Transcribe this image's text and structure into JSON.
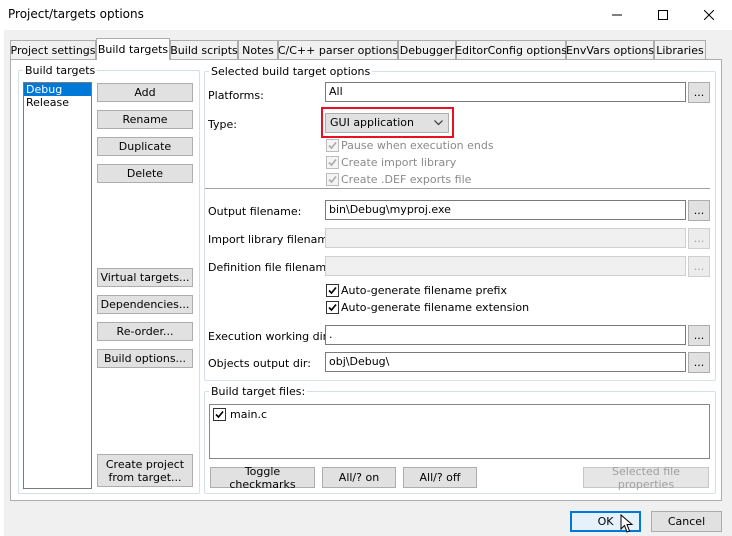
{
  "window": {
    "title": "Project/targets options"
  },
  "tabs": [
    {
      "label": "Project settings"
    },
    {
      "label": "Build targets"
    },
    {
      "label": "Build scripts"
    },
    {
      "label": "Notes"
    },
    {
      "label": "C/C++ parser options"
    },
    {
      "label": "Debugger"
    },
    {
      "label": "EditorConfig options"
    },
    {
      "label": "EnvVars options"
    },
    {
      "label": "Libraries"
    }
  ],
  "build_targets": {
    "label": "Build targets",
    "items": [
      "Debug",
      "Release"
    ],
    "selected": "Debug",
    "buttons": {
      "add": "Add",
      "rename": "Rename",
      "duplicate": "Duplicate",
      "delete": "Delete",
      "virtual_targets": "Virtual targets...",
      "dependencies": "Dependencies...",
      "reorder": "Re-order...",
      "build_options": "Build options...",
      "create_project": "Create project from target..."
    }
  },
  "options": {
    "label": "Selected build target options",
    "platforms_label": "Platforms:",
    "platforms_value": "All",
    "type_label": "Type:",
    "type_value": "GUI application",
    "pause_label": "Pause when execution ends",
    "import_lib_label": "Create import library",
    "def_exports_label": "Create .DEF exports file",
    "output_label": "Output filename:",
    "output_value": "bin\\Debug\\myproj.exe",
    "import_filename_label": "Import library filename:",
    "def_filename_label": "Definition file filename:",
    "prefix_label": "Auto-generate filename prefix",
    "extension_label": "Auto-generate filename extension",
    "workdir_label": "Execution working dir:",
    "workdir_value": ".",
    "objdir_label": "Objects output dir:",
    "objdir_value": "obj\\Debug\\",
    "browse": "..."
  },
  "files": {
    "label": "Build target files:",
    "items": [
      "main.c"
    ],
    "toggle": "Toggle checkmarks",
    "all_on": "All/? on",
    "all_off": "All/? off",
    "properties": "Selected file properties"
  },
  "footer": {
    "ok": "OK",
    "cancel": "Cancel"
  },
  "colors": {
    "accent": "#0078d7",
    "highlight_red": "#e81123"
  }
}
